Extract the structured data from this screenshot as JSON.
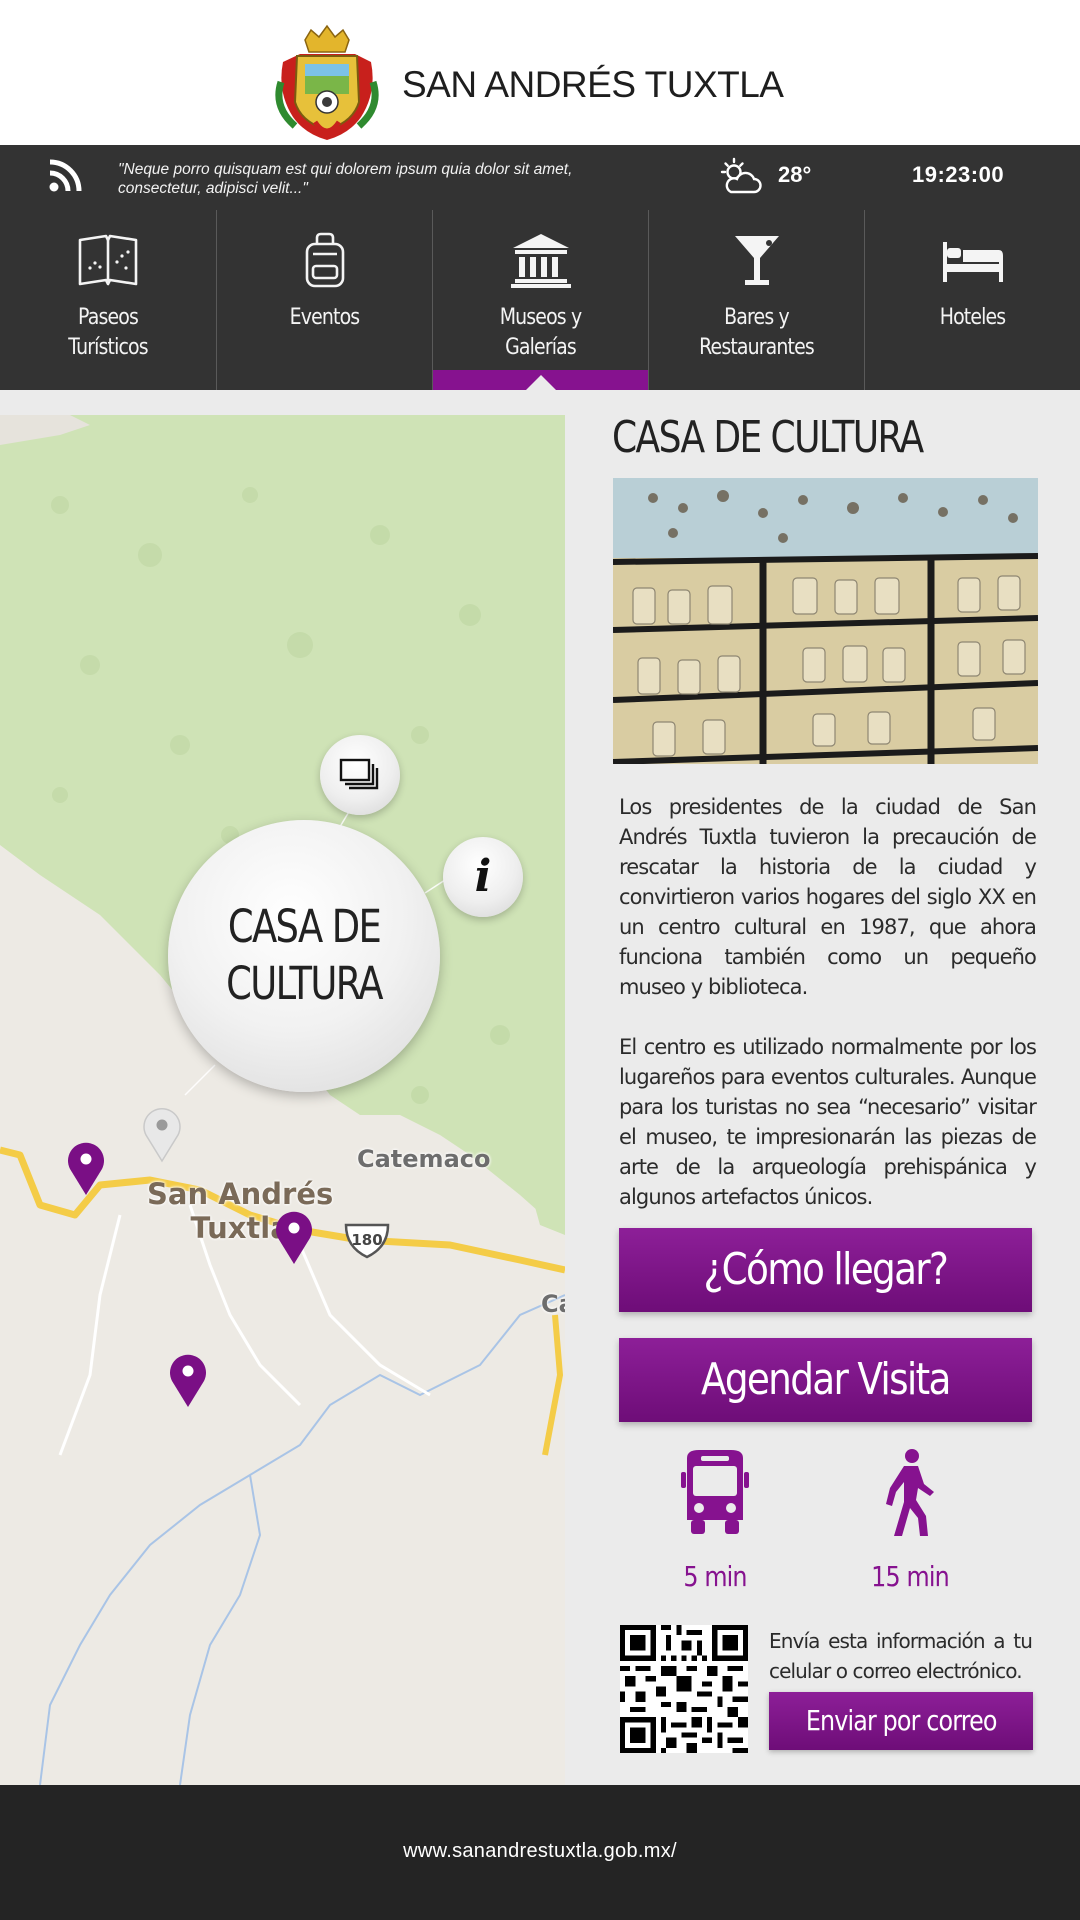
{
  "header": {
    "title": "SAN ANDRÉS TUXTLA",
    "crest_icon": "municipal-coat-of-arms-icon"
  },
  "infobar": {
    "rss_icon": "rss-feed-icon",
    "ticker_text": "\"Neque porro quisquam est qui dolorem ipsum quia dolor sit amet, consectetur, adipisci velit...\"",
    "weather_icon": "partly-cloudy-icon",
    "temperature": "28°",
    "time": "19:23:00"
  },
  "nav": {
    "active_index": 2,
    "accent_color": "#86128f",
    "items": [
      {
        "label": "Paseos\nTurísticos",
        "icon": "map-book-icon"
      },
      {
        "label": "Eventos",
        "icon": "backpack-icon"
      },
      {
        "label": "Museos y\nGalerías",
        "icon": "museum-icon"
      },
      {
        "label": "Bares y\nRestaurantes",
        "icon": "cocktail-glass-icon"
      },
      {
        "label": "Hoteles",
        "icon": "bed-icon"
      }
    ]
  },
  "map": {
    "labels": {
      "catemaco": "Catemaco",
      "city": "San Andrés\nTuxtla",
      "edge": "Ca",
      "route": "180"
    },
    "selected_place": "CASA DE\nCULTURA",
    "gallery_icon": "photo-gallery-icon",
    "info_icon": "info-icon",
    "pin_color": "#7a0f85"
  },
  "detail": {
    "title": "CASA DE CULTURA",
    "paragraphs": [
      "Los presidentes de la ciudad de San Andrés Tuxtla tuvieron la precaución de rescatar la historia de la ciudad y convirtieron varios hogares del siglo XX en un centro cultural en 1987, que ahora funciona también como un pequeño museo y biblioteca.",
      "El centro es utilizado normalmente por los lugareños para eventos culturales. Aunque para los turistas no sea “necesario” visitar el museo, te impresionarán las piezas de arte de la arqueología prehispánica y algunos artefactos únicos."
    ],
    "route_button": "¿Cómo llegar?",
    "schedule_button": "Agendar Visita",
    "travel": [
      {
        "mode_icon": "bus-icon",
        "time": "5 min"
      },
      {
        "mode_icon": "walking-person-icon",
        "time": "15 min"
      }
    ],
    "send_text": "Envía esta información a tu celular o correo electrónico.",
    "send_button": "Enviar por correo",
    "qr_icon": "qr-code-icon"
  },
  "footer": {
    "url": "www.sanandrestuxtla.gob.mx/"
  }
}
